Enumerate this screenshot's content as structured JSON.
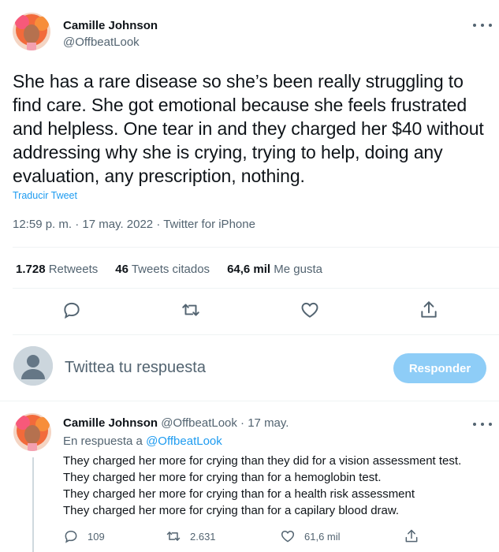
{
  "main_tweet": {
    "author_name": "Camille Johnson",
    "author_handle": "@OffbeatLook",
    "text": "She has a rare disease so she’s been really struggling to find care. She got emotional because she feels frustrated and helpless. One tear in and they charged her $40 without addressing why she is crying, trying to help, doing any evaluation, any prescription, nothing.",
    "translate_label": "Traducir Tweet",
    "meta": "12:59 p. m. · 17 may. 2022 · Twitter for iPhone",
    "stats": {
      "retweets_count": "1.728",
      "retweets_label": "Retweets",
      "quotes_count": "46",
      "quotes_label": "Tweets citados",
      "likes_count": "64,6 mil",
      "likes_label": "Me gusta"
    },
    "actions": [
      "reply-icon",
      "retweet-icon",
      "like-icon",
      "share-icon"
    ]
  },
  "reply_composer": {
    "placeholder": "Twittea tu respuesta",
    "button_label": "Responder"
  },
  "reply_tweet": {
    "author_name": "Camille Johnson",
    "author_handle_date": "@OffbeatLook · 17 may.",
    "in_reply_prefix": "En respuesta a",
    "in_reply_handle": "@OffbeatLook",
    "lines": [
      "They charged her more for crying than they did for a vision assessment test.",
      "They charged her more for crying than for a hemoglobin test.",
      "They charged her more for crying than for a health risk assessment",
      "They charged her more for crying than for a capilary blood draw."
    ],
    "replies_count": "109",
    "retweets_count": "2.631",
    "likes_count": "61,6 mil"
  },
  "colors": {
    "accent": "#1d9bf0",
    "reply_button": "#8ecdf7",
    "secondary_text": "#536471",
    "divider": "#eff3f4"
  }
}
